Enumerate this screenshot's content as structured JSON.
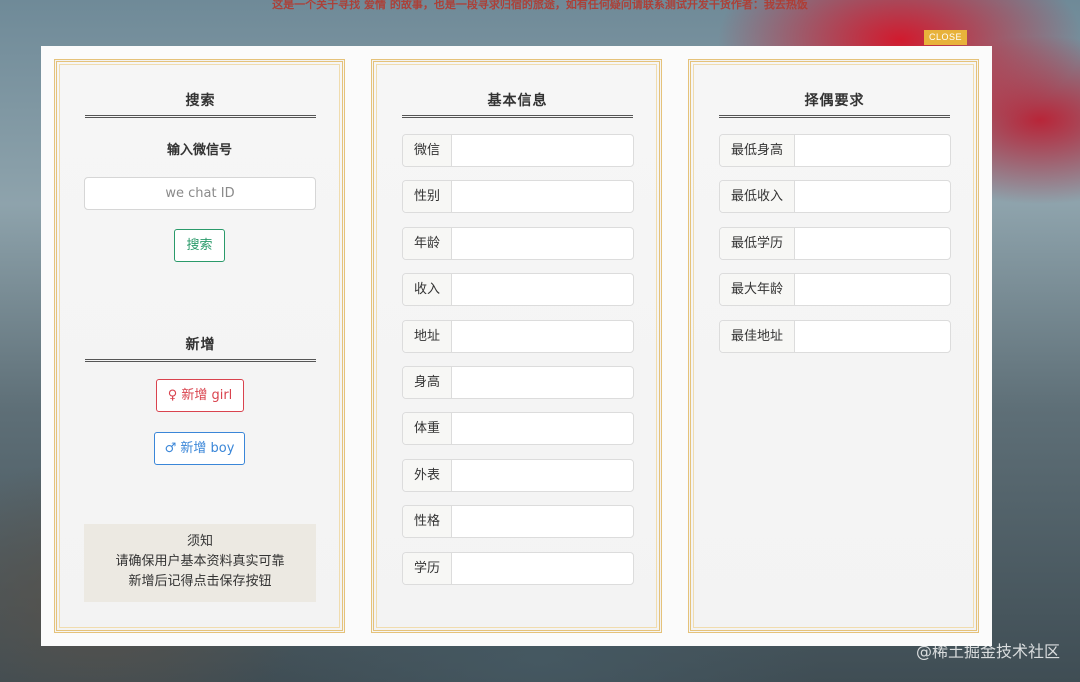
{
  "banner_text": "这是一个关于寻找 爱情 的故事，也是一段寻求归宿的旅途，如有任何疑问请联系测试开发干货作者：我去热饭",
  "close_label": "CLOSE",
  "search_panel": {
    "title": "搜索",
    "input_label": "输入微信号",
    "input_placeholder": "we chat ID",
    "search_button": "搜索",
    "add_title": "新增",
    "add_girl_button": "♀ 新增 girl",
    "add_boy_button": "♂ 新增 boy",
    "notice_lines": [
      "须知",
      "请确保用户基本资料真实可靠",
      "新增后记得点击保存按钮"
    ]
  },
  "basic_panel": {
    "title": "基本信息",
    "fields": [
      "微信",
      "性别",
      "年龄",
      "收入",
      "地址",
      "身高",
      "体重",
      "外表",
      "性格",
      "学历"
    ]
  },
  "req_panel": {
    "title": "择偶要求",
    "fields": [
      "最低身高",
      "最低收入",
      "最低学历",
      "最大年龄",
      "最佳地址"
    ]
  },
  "watermark": "@稀土掘金技术社区",
  "colors": {
    "panel_border": "#e5c27a",
    "close_bg": "#e8b23b",
    "search_btn": "#2a9a6a",
    "girl_btn": "#d9434e",
    "boy_btn": "#3a86d8"
  }
}
